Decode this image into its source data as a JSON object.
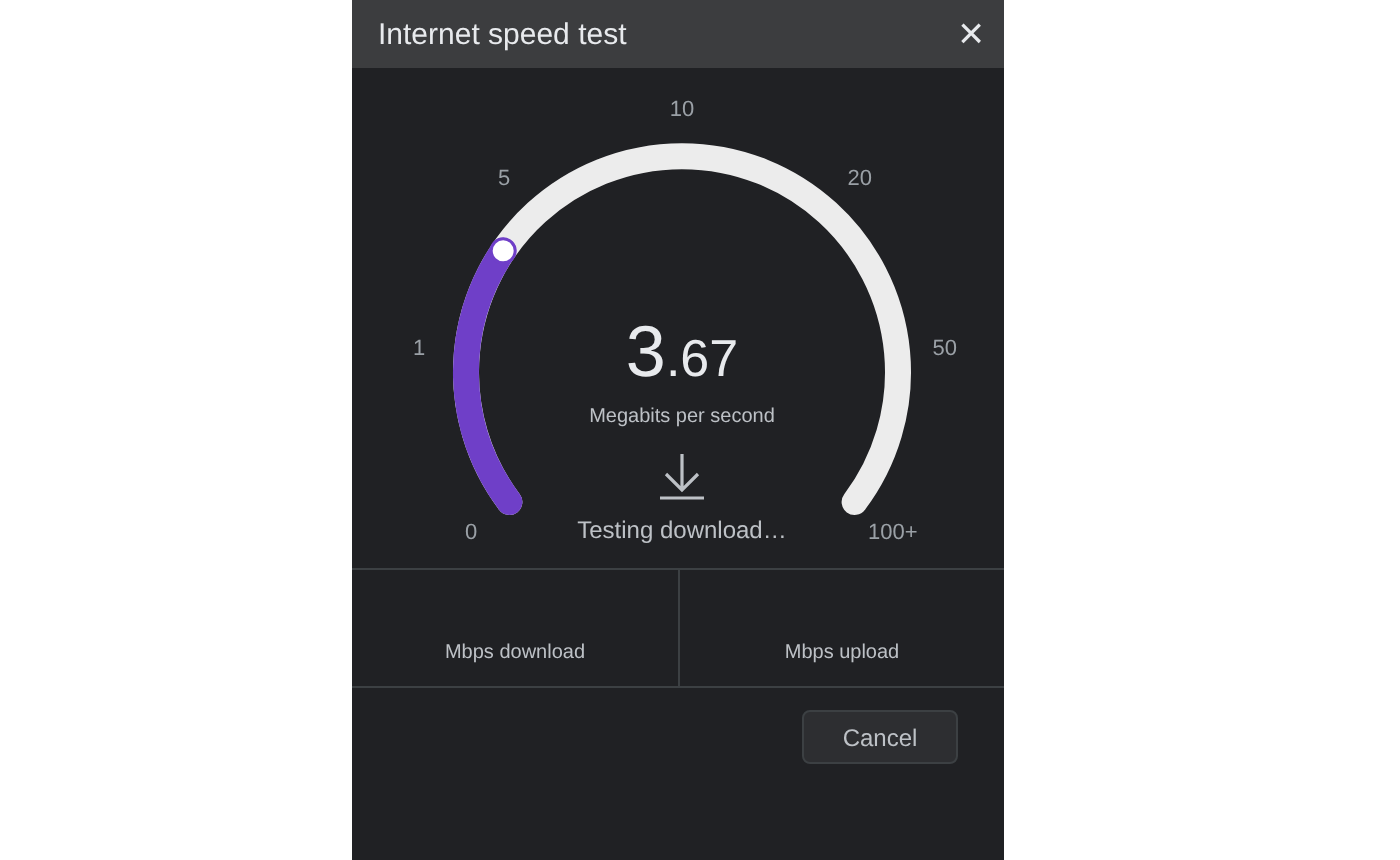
{
  "window": {
    "title": "Internet speed test",
    "close": "×"
  },
  "gauge": {
    "level": 0.28,
    "scale": [
      "0",
      "1",
      "5",
      "10",
      "20",
      "50",
      "100+"
    ],
    "reading_whole": "3",
    "reading_fraction": ".67",
    "unit": "Megabits per second"
  },
  "status": "Testing download…",
  "results": [
    {
      "label": "Mbps download"
    },
    {
      "label": "Mbps upload"
    }
  ],
  "buttons": [
    {
      "label": "Cancel"
    }
  ]
}
